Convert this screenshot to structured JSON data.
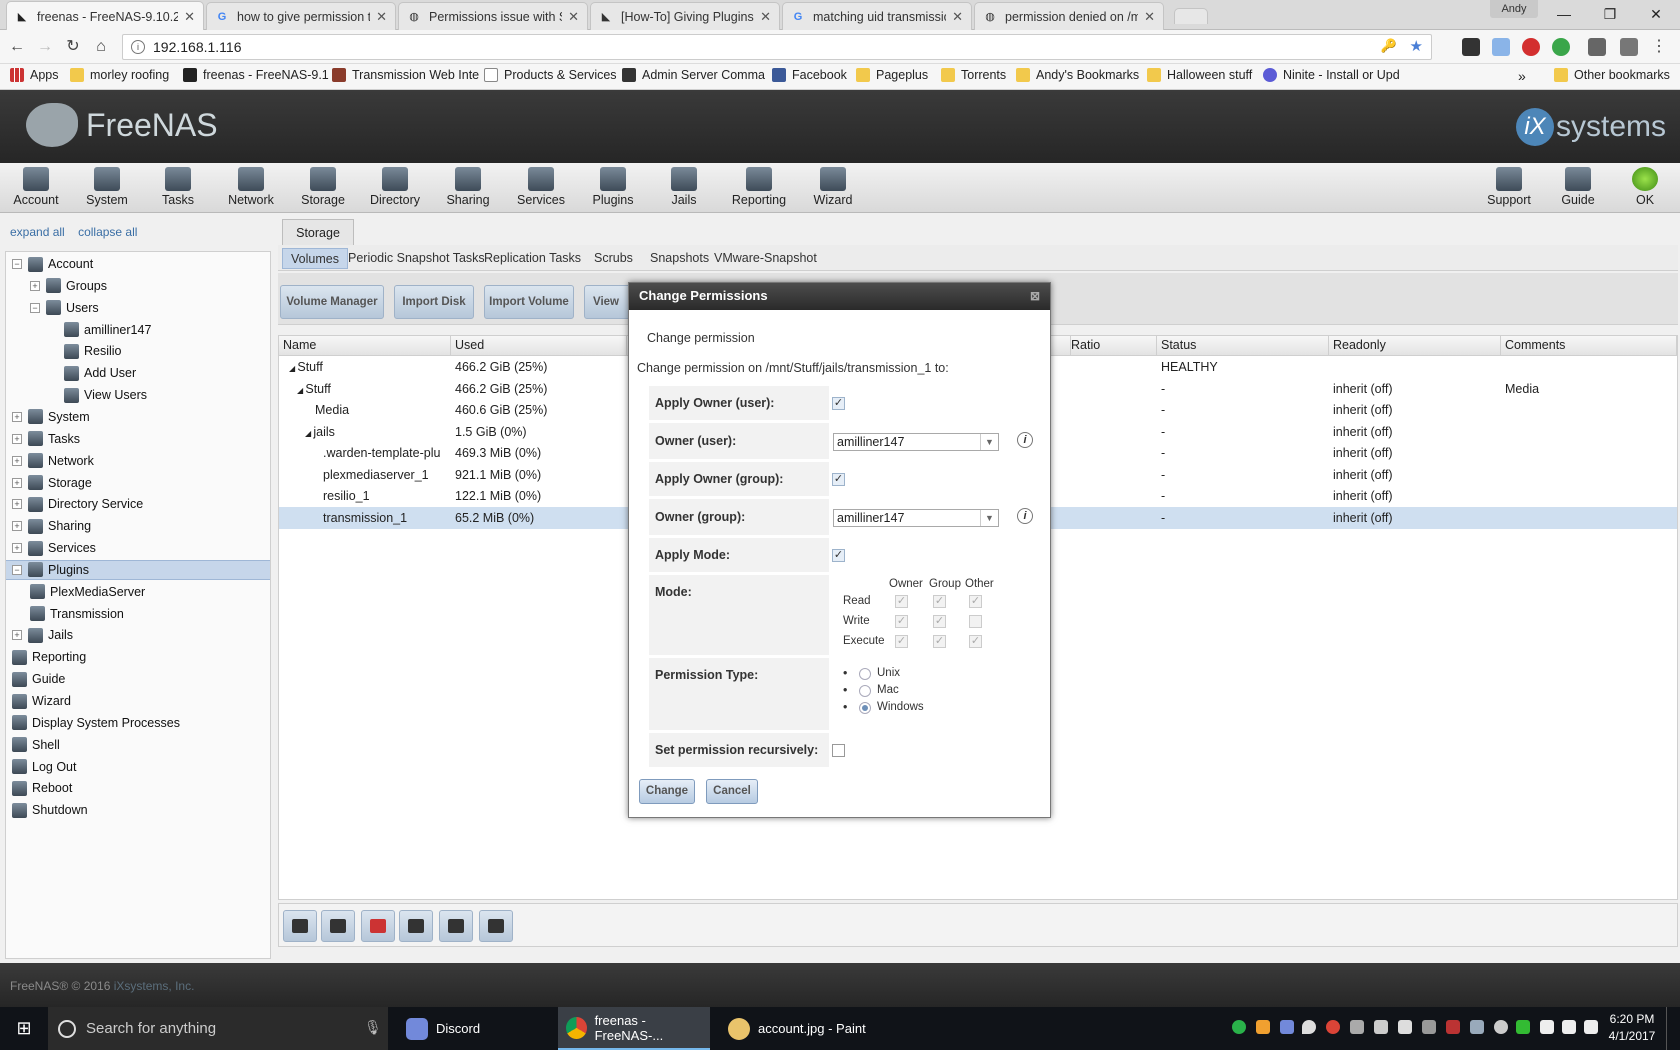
{
  "browser": {
    "tabs": [
      {
        "title": "freenas - FreeNAS-9.10.2",
        "active": true
      },
      {
        "title": "how to give permission t"
      },
      {
        "title": "Permissions issue with Sc"
      },
      {
        "title": "[How-To] Giving Plugins"
      },
      {
        "title": "matching uid transmissio"
      },
      {
        "title": "permission denied on /m"
      }
    ],
    "profile": "Andy",
    "url": "192.168.1.116",
    "bookmarks": [
      "Apps",
      "morley roofing",
      "freenas - FreeNAS-9.1",
      "Transmission Web Inte",
      "Products & Services",
      "Admin Server Comma",
      "Facebook",
      "Pageplus",
      "Torrents",
      "Andy's Bookmarks",
      "Halloween stuff",
      "Ninite - Install or Upd",
      "Other bookmarks"
    ],
    "more": "»"
  },
  "app": {
    "logo_text": "FreeNAS",
    "vendor_logo": {
      "i": "iX",
      "text": "systems"
    },
    "menu": [
      "Account",
      "System",
      "Tasks",
      "Network",
      "Storage",
      "Directory",
      "Sharing",
      "Services",
      "Plugins",
      "Jails",
      "Reporting",
      "Wizard"
    ],
    "menu_right": [
      "Support",
      "Guide",
      "OK"
    ],
    "footer": {
      "text": "FreeNAS® © 2016 ",
      "company": "iXsystems, Inc."
    }
  },
  "tree": {
    "expand_all": "expand all",
    "collapse_all": "collapse all",
    "items": [
      {
        "label": "Account",
        "level": 0,
        "toggle": "−"
      },
      {
        "label": "Groups",
        "level": 1,
        "toggle": "+"
      },
      {
        "label": "Users",
        "level": 1,
        "toggle": "−"
      },
      {
        "label": "amilliner147",
        "level": 2
      },
      {
        "label": "Resilio",
        "level": 2
      },
      {
        "label": "Add User",
        "level": 2
      },
      {
        "label": "View Users",
        "level": 2
      },
      {
        "label": "System",
        "level": 0,
        "toggle": "+"
      },
      {
        "label": "Tasks",
        "level": 0,
        "toggle": "+"
      },
      {
        "label": "Network",
        "level": 0,
        "toggle": "+"
      },
      {
        "label": "Storage",
        "level": 0,
        "toggle": "+"
      },
      {
        "label": "Directory Service",
        "level": 0,
        "toggle": "+"
      },
      {
        "label": "Sharing",
        "level": 0,
        "toggle": "+"
      },
      {
        "label": "Services",
        "level": 0,
        "toggle": "+"
      },
      {
        "label": "Plugins",
        "level": 0,
        "toggle": "−",
        "selected": true
      },
      {
        "label": "PlexMediaServer",
        "level": 1
      },
      {
        "label": "Transmission",
        "level": 1
      },
      {
        "label": "Jails",
        "level": 0,
        "toggle": "+"
      },
      {
        "label": "Reporting",
        "level": 0
      },
      {
        "label": "Guide",
        "level": 0
      },
      {
        "label": "Wizard",
        "level": 0
      },
      {
        "label": "Display System Processes",
        "level": 0
      },
      {
        "label": "Shell",
        "level": 0
      },
      {
        "label": "Log Out",
        "level": 0
      },
      {
        "label": "Reboot",
        "level": 0
      },
      {
        "label": "Shutdown",
        "level": 0
      }
    ]
  },
  "storage": {
    "tab": "Storage",
    "subtabs": [
      "Volumes",
      "Periodic Snapshot Tasks",
      "Replication Tasks",
      "Scrubs",
      "Snapshots",
      "VMware-Snapshot"
    ],
    "actions": [
      "Volume Manager",
      "Import Disk",
      "Import Volume",
      "View"
    ],
    "columns": [
      "Name",
      "Used",
      "Ratio",
      "Status",
      "Readonly",
      "Comments"
    ],
    "rows": [
      {
        "name": "Stuff",
        "prefix": "◢ ",
        "used": "466.2 GiB (25%)",
        "status": "HEALTHY",
        "readonly": "",
        "comments": ""
      },
      {
        "name": "Stuff",
        "prefix": "◢ ",
        "used": "466.2 GiB (25%)",
        "status": "-",
        "readonly": "inherit (off)",
        "comments": "Media"
      },
      {
        "name": "Media",
        "prefix": "",
        "used": "460.6 GiB (25%)",
        "status": "-",
        "readonly": "inherit (off)",
        "comments": ""
      },
      {
        "name": "jails",
        "prefix": "◢ ",
        "used": "1.5 GiB (0%)",
        "status": "-",
        "readonly": "inherit (off)",
        "comments": ""
      },
      {
        "name": ".warden-template-plu",
        "prefix": "",
        "used": "469.3 MiB (0%)",
        "status": "-",
        "readonly": "inherit (off)",
        "comments": ""
      },
      {
        "name": "plexmediaserver_1",
        "prefix": "",
        "used": "921.1 MiB (0%)",
        "status": "-",
        "readonly": "inherit (off)",
        "comments": ""
      },
      {
        "name": "resilio_1",
        "prefix": "",
        "used": "122.1 MiB (0%)",
        "status": "-",
        "readonly": "inherit (off)",
        "comments": ""
      },
      {
        "name": "transmission_1",
        "prefix": "",
        "used": "65.2 MiB (0%)",
        "status": "-",
        "readonly": "inherit (off)",
        "comments": "",
        "selected": true
      }
    ]
  },
  "dialog": {
    "title": "Change Permissions",
    "close": "⊠",
    "subtitle": "Change permission",
    "path_text": "Change permission on /mnt/Stuff/jails/transmission_1 to:",
    "apply_owner_user": {
      "label": "Apply Owner (user):",
      "checked": true
    },
    "owner_user": {
      "label": "Owner (user):",
      "value": "amilliner147"
    },
    "apply_owner_group": {
      "label": "Apply Owner (group):",
      "checked": true
    },
    "owner_group": {
      "label": "Owner (group):",
      "value": "amilliner147"
    },
    "apply_mode": {
      "label": "Apply Mode:",
      "checked": true
    },
    "mode": {
      "label": "Mode:",
      "cols": [
        "Owner",
        "Group",
        "Other"
      ],
      "rows": [
        {
          "name": "Read",
          "values": [
            true,
            true,
            true
          ]
        },
        {
          "name": "Write",
          "values": [
            true,
            true,
            false
          ]
        },
        {
          "name": "Execute",
          "values": [
            true,
            true,
            true
          ]
        }
      ]
    },
    "permission_type": {
      "label": "Permission Type:",
      "options": [
        "Unix",
        "Mac",
        "Windows"
      ],
      "selected": "Windows"
    },
    "recursive": {
      "label": "Set permission recursively:",
      "checked": false
    },
    "change_button": "Change",
    "cancel_button": "Cancel"
  },
  "taskbar": {
    "search_placeholder": "Search for anything",
    "apps": [
      {
        "label": "Discord"
      },
      {
        "label": "freenas - FreeNAS-...",
        "active": true
      },
      {
        "label": "account.jpg - Paint"
      }
    ],
    "time": "6:20 PM",
    "date": "4/1/2017"
  }
}
